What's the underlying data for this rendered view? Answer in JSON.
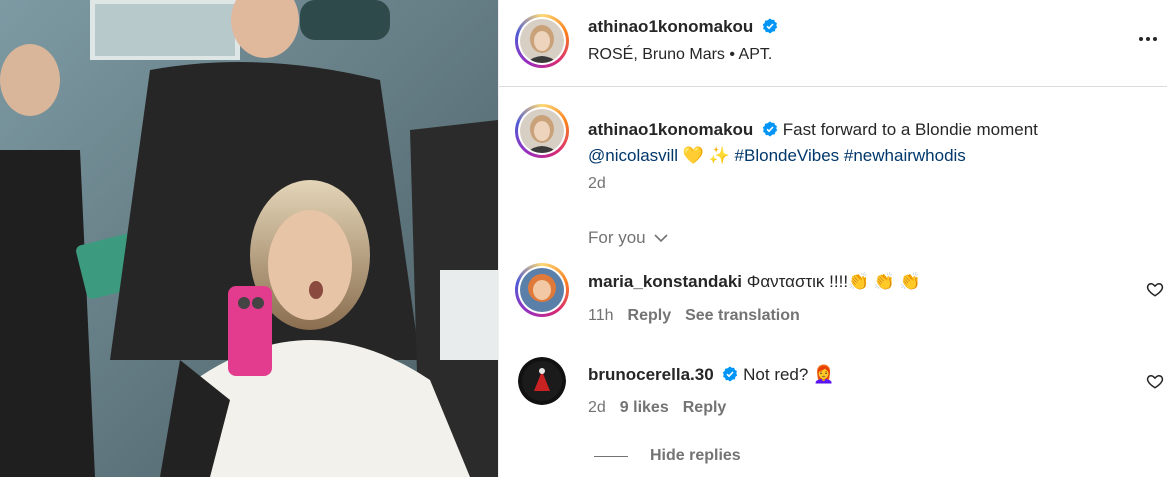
{
  "header": {
    "username": "athinao1konomakou",
    "audio": "ROSÉ, Bruno Mars • APT.",
    "more_icon": "more-horizontal-icon"
  },
  "caption": {
    "username": "athinao1konomakou",
    "text": "Fast forward to a Blondie moment",
    "mention": "@nicolasvill",
    "emojis": "💛 ✨",
    "hashtags": [
      "#BlondeVibes",
      "#newhairwhodis"
    ],
    "time": "2d"
  },
  "section_label": "For you",
  "comments": [
    {
      "username": "maria_konstandaki",
      "text": "Φανταστικ !!!!👏 👏 👏",
      "time": "11h",
      "reply": "Reply",
      "translate": "See translation"
    },
    {
      "username": "brunocerella.30",
      "text": "Not red? 👩‍🦰",
      "time": "2d",
      "likes": "9 likes",
      "reply": "Reply"
    }
  ],
  "hide_replies": "Hide replies",
  "colors": {
    "link": "#00376b",
    "verified": "#0095f6",
    "muted": "#737373"
  }
}
